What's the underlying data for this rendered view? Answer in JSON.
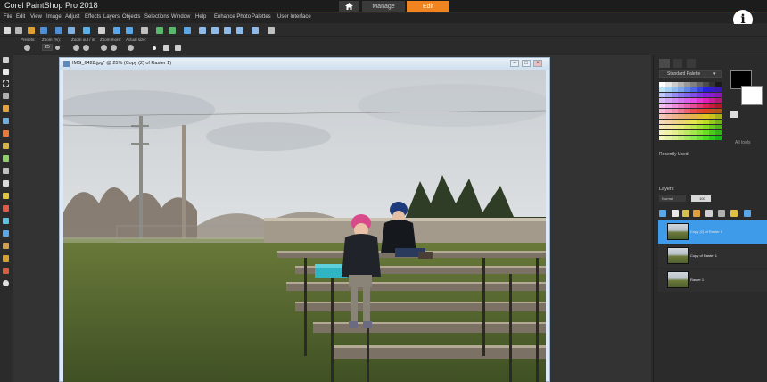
{
  "app": {
    "title": "Corel PaintShop Pro 2018",
    "workspaces": {
      "manage": "Manage",
      "edit": "Edit"
    },
    "info_glyph": "i"
  },
  "menu": [
    "File",
    "Edit",
    "View",
    "Image",
    "Adjust",
    "Effects",
    "Layers",
    "Objects",
    "Selections",
    "Window",
    "Help",
    "Enhance Photo",
    "Palettes",
    "User Interface"
  ],
  "tool_options": {
    "presets": "Presets:",
    "zoom_percent": "Zoom (%):",
    "zoom_value": "25",
    "zoom_out_in": "Zoom out / in:",
    "zoom_more": "Zoom more:",
    "actual_size": "Actual size:"
  },
  "document": {
    "title": "IMG_6428.jpg* @  25% (Copy (2) of Raster 1)",
    "buttons": {
      "minimize": "–",
      "maximize": "□",
      "close": "×"
    }
  },
  "materials": {
    "palette_select": "Standard Palette",
    "all_tools": "All tools",
    "recently_used": "Recently Used"
  },
  "layers": {
    "title": "Layers",
    "blend_mode": "Normal",
    "opacity": "100",
    "items": [
      {
        "name": "Copy (2) of Raster 1",
        "selected": true
      },
      {
        "name": "Copy of Raster 1",
        "selected": false
      },
      {
        "name": "Raster 1",
        "selected": false
      }
    ]
  },
  "colors": {
    "accent": "#f08420",
    "layer_selected": "#3d9be9",
    "window_bg": "#2b2b2b"
  }
}
